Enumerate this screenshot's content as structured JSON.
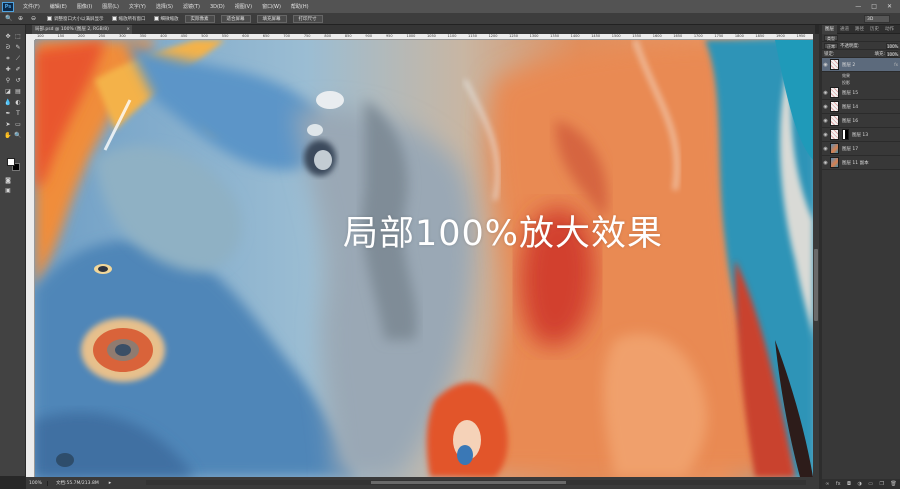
{
  "app": {
    "logo": "Ps"
  },
  "menu": [
    "文件(F)",
    "编辑(E)",
    "图像(I)",
    "图层(L)",
    "文字(Y)",
    "选择(S)",
    "滤镜(T)",
    "3D(D)",
    "视图(V)",
    "窗口(W)",
    "帮助(H)"
  ],
  "window_controls": [
    "—",
    "□",
    "✕"
  ],
  "options_bar": {
    "check1": "调整窗口大小以满屏显示",
    "check2": "缩放所有窗口",
    "check3": "细微缩放",
    "btn1": "实际像素",
    "btn2": "适合屏幕",
    "btn3": "填充屏幕",
    "btn4": "打印尺寸",
    "workspace": "3D"
  },
  "doc_tab": {
    "title": "局部.psd @ 100% (图层 2, RGB/8)",
    "close": "×"
  },
  "ruler_ticks": [
    "100",
    "150",
    "200",
    "250",
    "300",
    "350",
    "400",
    "450",
    "500",
    "550",
    "600",
    "650",
    "700",
    "750",
    "800",
    "850",
    "900",
    "950",
    "1000",
    "1050",
    "1100",
    "1150",
    "1200",
    "1250",
    "1300",
    "1350",
    "1400",
    "1450",
    "1500",
    "1550",
    "1600",
    "1650",
    "1700",
    "1750",
    "1800",
    "1850",
    "1900",
    "1950"
  ],
  "canvas": {
    "caption": "局部100%放大效果"
  },
  "status": {
    "zoom": "100%",
    "doc": "文档:55.7M/213.8M",
    "arrow": "▸"
  },
  "layers_panel": {
    "tabs": [
      "图层",
      "通道",
      "路径",
      "历史",
      "动作"
    ],
    "kind_label": "类型",
    "blend_mode": "正常",
    "opacity_label": "不透明度:",
    "opacity": "100%",
    "lock_label": "锁定:",
    "fill_label": "填充:",
    "fill": "100%",
    "layers": [
      {
        "name": "图层 2",
        "selected": true,
        "fx": "fx",
        "type": "pattern"
      },
      {
        "name": "效果",
        "sub": true
      },
      {
        "name": "投影",
        "sub": true
      },
      {
        "name": "图层 15",
        "type": "pattern"
      },
      {
        "name": "图层 14",
        "type": "pattern"
      },
      {
        "name": "图层 16",
        "type": "pattern"
      },
      {
        "name": "图层 13",
        "type": "mask"
      },
      {
        "name": "图层 17",
        "type": "image"
      },
      {
        "name": "图层 11 副本",
        "type": "image"
      }
    ],
    "footer_icons": [
      "link-icon",
      "fx-icon",
      "mask-icon",
      "adjustment-icon",
      "folder-icon",
      "new-layer-icon",
      "trash-icon"
    ]
  }
}
